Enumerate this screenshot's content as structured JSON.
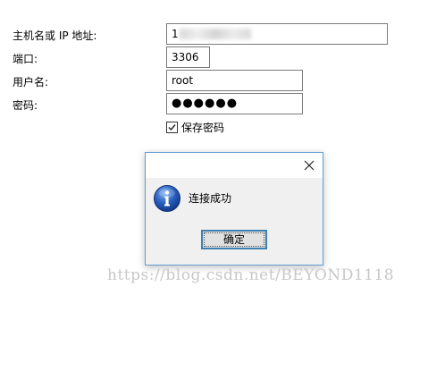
{
  "form": {
    "host_label": "主机名或 IP 地址:",
    "host_value": "1",
    "port_label": "端口:",
    "port_value": "3306",
    "user_label": "用户名:",
    "user_value": "root",
    "password_label": "密码:",
    "password_value": "●●●●●●",
    "save_password_label": "保存密码",
    "save_password_checked": true
  },
  "dialog": {
    "icon": "info-icon",
    "message": "连接成功",
    "ok_label": "确定",
    "close_glyph": "✕"
  },
  "watermark": "https://blog.csdn.net/BEYOND1118"
}
